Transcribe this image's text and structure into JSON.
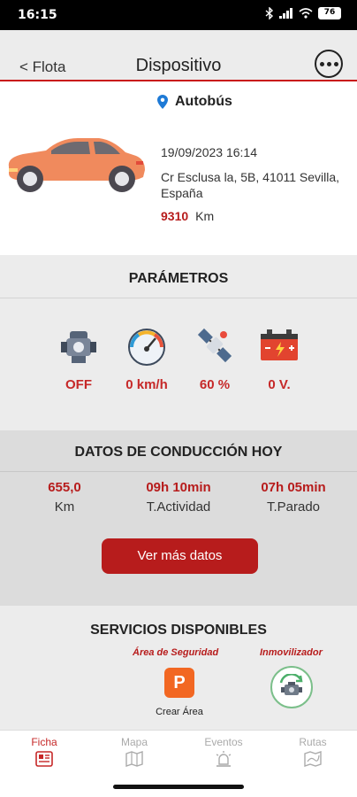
{
  "status_bar": {
    "time": "16:15",
    "battery": "76"
  },
  "header": {
    "back_label": "< Flota",
    "title": "Dispositivo",
    "more_icon": "more-icon"
  },
  "vehicle": {
    "type": "Autobús",
    "datetime": "19/09/2023 16:14",
    "address": "Cr Esclusa la, 5B, 41011 Sevilla, España",
    "km_value": "9310",
    "km_unit": "Km",
    "car_color": "#f08a5d"
  },
  "parameters": {
    "title": "PARÁMETROS",
    "items": [
      {
        "icon": "engine-icon",
        "value": "OFF"
      },
      {
        "icon": "speedometer-icon",
        "value": "0 km/h"
      },
      {
        "icon": "satellite-icon",
        "value": "60 %"
      },
      {
        "icon": "battery-icon",
        "value": "0 V."
      }
    ]
  },
  "driving": {
    "title": "DATOS DE CONDUCCIÓN HOY",
    "stats": [
      {
        "value": "655,0",
        "label": "Km"
      },
      {
        "value": "09h 10min",
        "label": "T.Actividad"
      },
      {
        "value": "07h 05min",
        "label": "T.Parado"
      }
    ],
    "more_button": "Ver más datos"
  },
  "services": {
    "title": "SERVICIOS DISPONIBLES",
    "security_area_label": "Área de Seguridad",
    "immobilizer_label": "Inmovilizador",
    "create_area_caption": "Crear Área",
    "parking_letter": "P"
  },
  "nav": {
    "items": [
      {
        "label": "Ficha",
        "active": true
      },
      {
        "label": "Mapa",
        "active": false
      },
      {
        "label": "Eventos",
        "active": false
      },
      {
        "label": "Rutas",
        "active": false
      }
    ]
  },
  "colors": {
    "accent": "#b71c1c",
    "orange": "#f26722"
  }
}
